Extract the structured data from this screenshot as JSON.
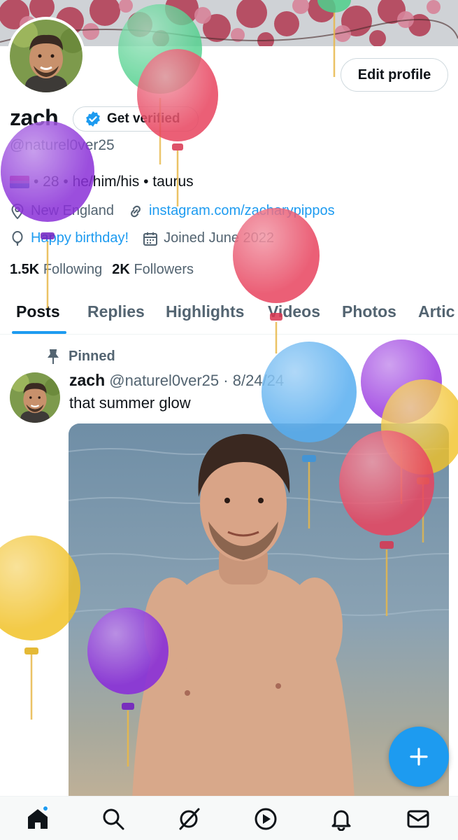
{
  "profile": {
    "name": "zach",
    "handle": "@naturel0ver25",
    "edit_label": "Edit profile",
    "verify_label": "Get verified",
    "bio": "• 28 • he/him/his • taurus",
    "location": "New England",
    "website": "instagram.com/zacharypippos",
    "birthday": "Happy birthday!",
    "joined": "Joined June 2022",
    "following_count": "1.5K",
    "following_label": "Following",
    "followers_count": "2K",
    "followers_label": "Followers"
  },
  "tabs": [
    {
      "label": "Posts",
      "active": true
    },
    {
      "label": "Replies",
      "active": false
    },
    {
      "label": "Highlights",
      "active": false
    },
    {
      "label": "Videos",
      "active": false
    },
    {
      "label": "Photos",
      "active": false
    },
    {
      "label": "Artic",
      "active": false
    }
  ],
  "post": {
    "pinned_label": "Pinned",
    "author": "zach",
    "handle": "@naturel0ver25",
    "separator": "·",
    "date": "8/24/24",
    "text": "that summer glow"
  },
  "nav": {
    "items": [
      "home-icon",
      "search-icon",
      "grok-icon",
      "video-icon",
      "bell-icon",
      "mail-icon"
    ]
  },
  "colors": {
    "accent": "#1d9bf0",
    "text": "#0f1419",
    "muted": "#536471"
  }
}
